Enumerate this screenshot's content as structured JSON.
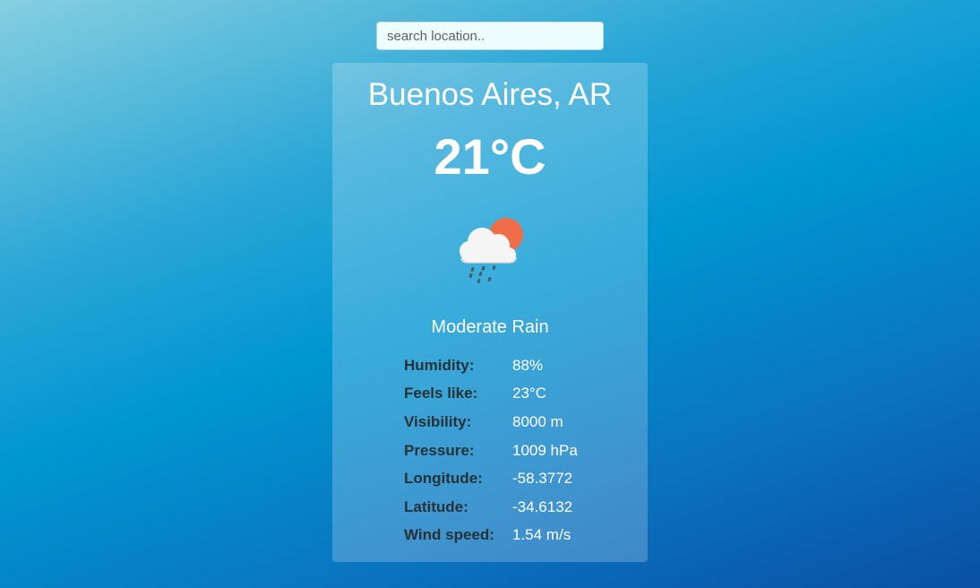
{
  "search": {
    "placeholder": "search location..",
    "value": ""
  },
  "weather": {
    "location": "Buenos Aires, AR",
    "temperature": "21°C",
    "icon": "cloud-sun-rain-icon",
    "condition": "Moderate Rain",
    "details": [
      {
        "label": "Humidity:",
        "value": "88%"
      },
      {
        "label": "Feels like:",
        "value": "23°C"
      },
      {
        "label": "Visibility:",
        "value": "8000 m"
      },
      {
        "label": "Pressure:",
        "value": "1009 hPa"
      },
      {
        "label": "Longitude:",
        "value": "-58.3772"
      },
      {
        "label": "Latitude:",
        "value": "-34.6132"
      },
      {
        "label": "Wind speed:",
        "value": "1.54 m/s"
      }
    ]
  },
  "colors": {
    "sun": "#ee6e4a",
    "cloud": "#f5f5f5",
    "rain": "#455a64",
    "label_text": "#263238",
    "value_text": "#ffffff"
  }
}
